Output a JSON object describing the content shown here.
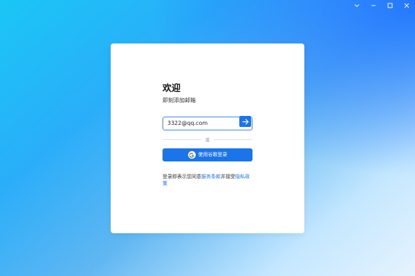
{
  "window": {
    "controls": [
      "chevron-down-icon",
      "minimize-icon",
      "maximize-icon",
      "close-icon"
    ]
  },
  "login": {
    "title": "欢迎",
    "subtitle": "即刻添加邮箱",
    "email_value": "3322@qq.com",
    "submit_icon": "arrow-right-icon",
    "divider_text": "或",
    "google_button_label": "使用谷歌登录",
    "google_icon": "google-g-icon",
    "terms": {
      "prefix": "登录即表示您同意",
      "terms_link": "服务条款",
      "middle": "并接受",
      "privacy_link": "隐私政策"
    }
  },
  "colors": {
    "accent": "#1b75ea",
    "input_border": "#3b83f0",
    "card_bg": "#ffffff"
  }
}
